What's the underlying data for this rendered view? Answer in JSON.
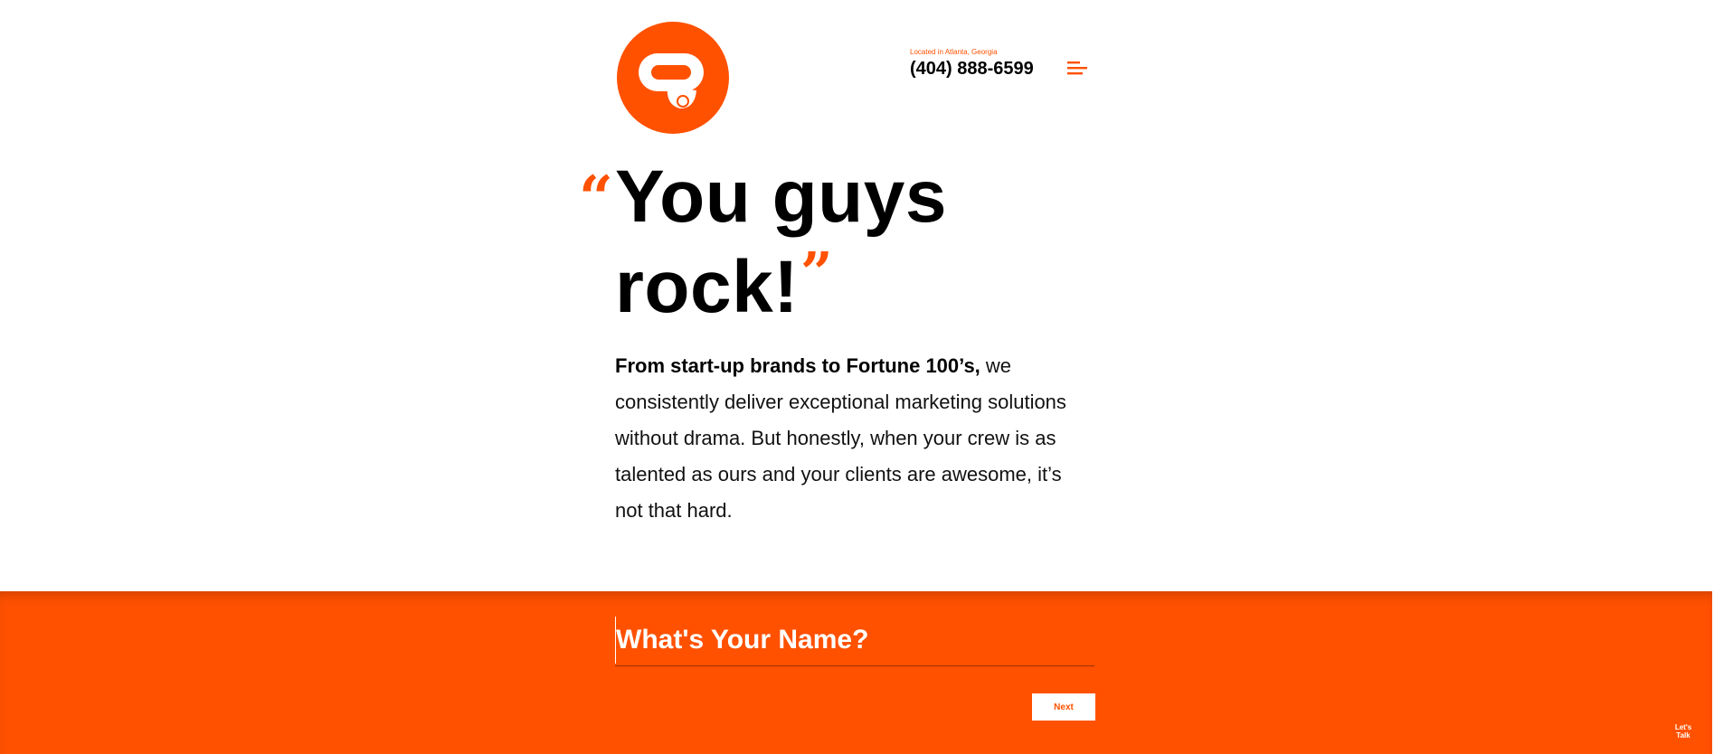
{
  "brand": {
    "accent_color": "#ff5100",
    "logo_icon": "speech-bubble-logo-icon"
  },
  "header": {
    "location": "Located in Atlanta, Georgia",
    "phone": "(404) 888-6599",
    "menu_icon": "hamburger-menu-icon"
  },
  "hero": {
    "quote_open": "“",
    "line1": "You guys",
    "line2_word": "rock",
    "line2_punct": "!",
    "quote_close": "”"
  },
  "intro": {
    "lead": "From start-up brands to Fortune 100’s,",
    "body": " we consistently deliver exceptional marketing solutions without drama. But honestly, when your crew is as talented as ours and your clients are awesome, it’s not that hard."
  },
  "form": {
    "name_placeholder": "What's Your Name?",
    "name_value": "",
    "next_label": "Next"
  },
  "chat": {
    "label_line1": "Let's",
    "label_line2": "Talk"
  }
}
